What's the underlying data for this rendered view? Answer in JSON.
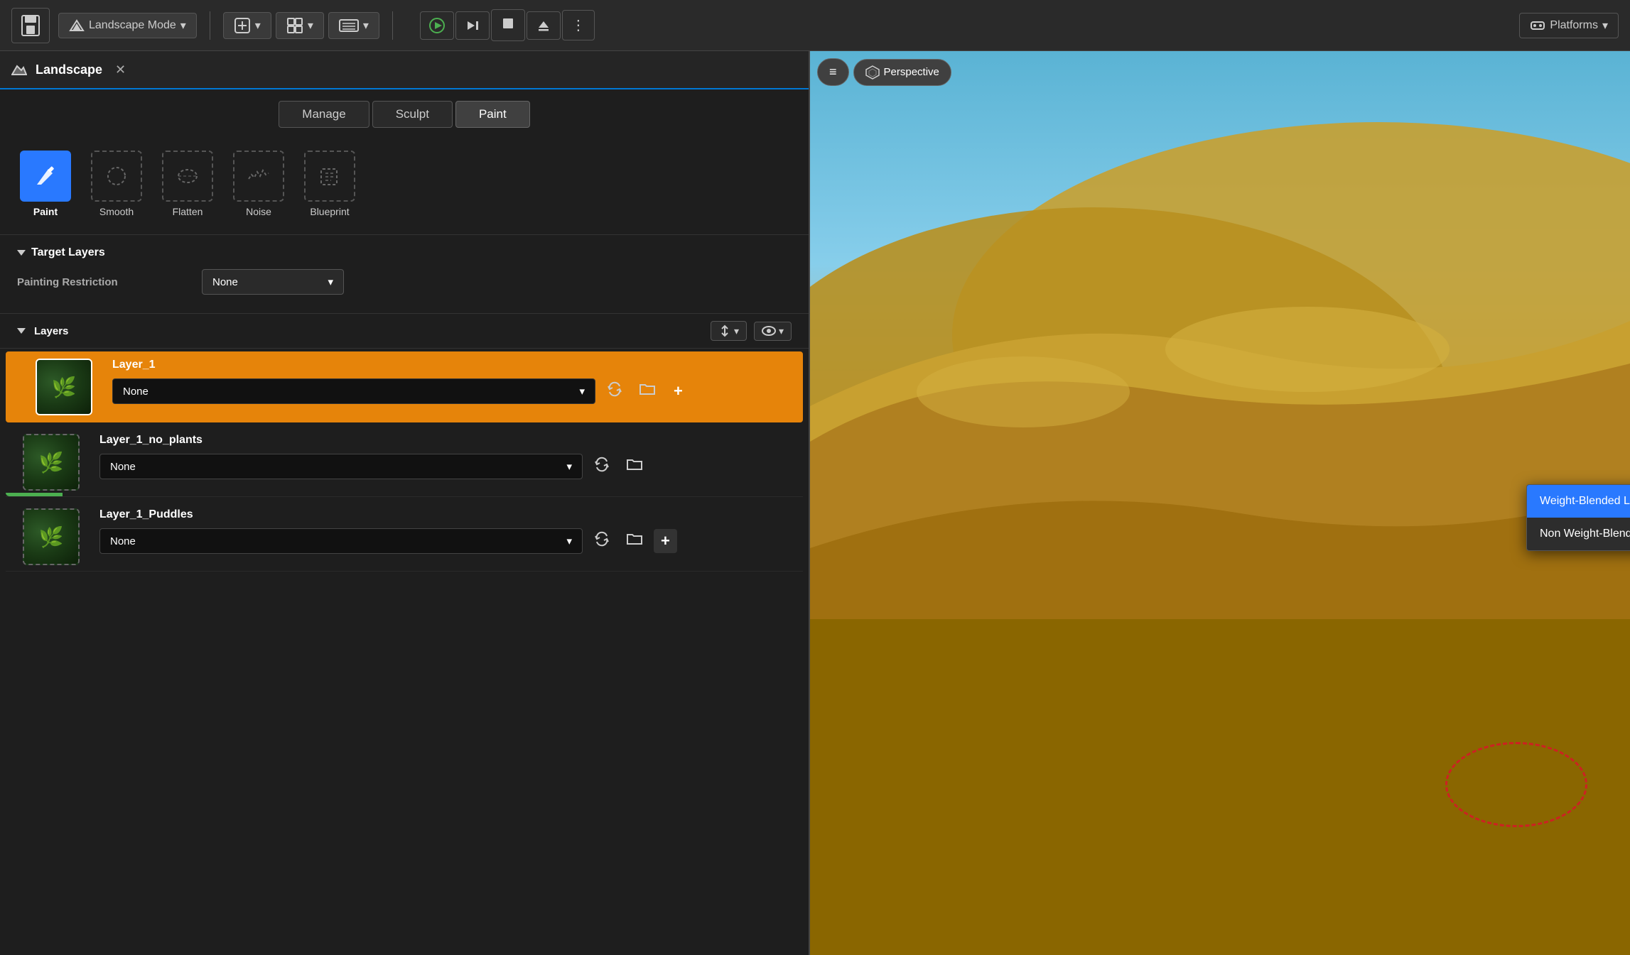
{
  "toolbar": {
    "save_label": "💾",
    "mode_label": "Landscape Mode",
    "mode_dropdown": "▾",
    "add_icon": "➕",
    "transform_icon": "⊞",
    "sequence_icon": "🎬",
    "play_icon": "▶",
    "step_icon": "⏵",
    "stop_icon": "⏹",
    "eject_icon": "⏏",
    "more_icon": "⋮",
    "platforms_icon": "🎮",
    "platforms_label": "Platforms",
    "platforms_dropdown": "▾"
  },
  "panel": {
    "icon": "⛰",
    "title": "Landscape",
    "close": "✕"
  },
  "mode_tabs": [
    {
      "label": "Manage",
      "active": false
    },
    {
      "label": "Sculpt",
      "active": false
    },
    {
      "label": "Paint",
      "active": true
    }
  ],
  "tools": [
    {
      "label": "Paint",
      "active": true,
      "icon": "✏"
    },
    {
      "label": "Smooth",
      "active": false,
      "icon": "○"
    },
    {
      "label": "Flatten",
      "active": false,
      "icon": "▬"
    },
    {
      "label": "Noise",
      "active": false,
      "icon": "〰"
    },
    {
      "label": "Blueprint",
      "active": false,
      "icon": "📋"
    }
  ],
  "target_layers": {
    "section_title": "Target Layers",
    "painting_restriction_label": "Painting Restriction",
    "painting_restriction_value": "None"
  },
  "layers_section": {
    "title": "Layers",
    "sort_icon": "↕",
    "visibility_icon": "👁"
  },
  "layers": [
    {
      "name": "Layer_1",
      "select_value": "None",
      "active": true,
      "has_add": true,
      "green_stripe": false
    },
    {
      "name": "Layer_1_no_plants",
      "select_value": "None",
      "active": false,
      "has_add": false,
      "green_stripe": true
    },
    {
      "name": "Layer_1_Puddles",
      "select_value": "None",
      "active": false,
      "has_add": true,
      "green_stripe": false
    }
  ],
  "dropdown_popup": {
    "items": [
      {
        "label": "Weight-Blended Layer (normal)",
        "selected": true
      },
      {
        "label": "Non Weight-Blended Layer",
        "selected": false
      }
    ]
  },
  "viewport": {
    "perspective_icon": "⬡",
    "perspective_label": "Perspective",
    "hamburger_icon": "≡"
  }
}
